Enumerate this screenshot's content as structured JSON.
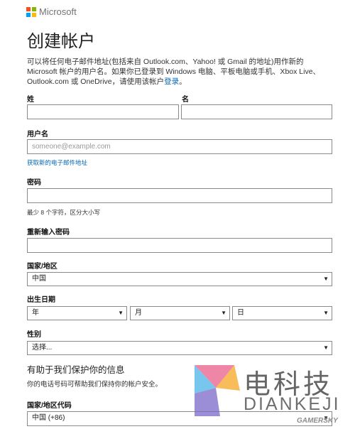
{
  "header": {
    "brand": "Microsoft",
    "logo_colors": [
      "#f25022",
      "#7fba00",
      "#00a4ef",
      "#ffb900"
    ]
  },
  "page_title": "创建帐户",
  "intro": {
    "text_before_link": "可以将任何电子邮件地址(包括来自 Outlook.com、Yahoo! 或 Gmail 的地址)用作新的 Microsoft 帐户的用户名。如果你已登录到 Windows 电脑、平板电脑或手机、Xbox Live、Outlook.com 或 OneDrive，请使用该帐户",
    "link": "登录",
    "text_after_link": "。"
  },
  "fields": {
    "last_name_label": "姓",
    "first_name_label": "名",
    "username_label": "用户名",
    "username_placeholder": "someone@example.com",
    "get_new_email_link": "获取新的电子邮件地址",
    "password_label": "密码",
    "password_hint": "最少 8 个字符，区分大小写",
    "reenter_password_label": "重新输入密码",
    "country_label": "国家/地区",
    "country_value": "中国",
    "birthdate_label": "出生日期",
    "birth_year_value": "年",
    "birth_month_value": "月",
    "birth_day_value": "日",
    "gender_label": "性别",
    "gender_value": "选择...",
    "security_section_title": "有助于我们保护你的信息",
    "security_section_desc": "你的电话号码可帮助我们保持你的帐户安全。",
    "country_code_label": "国家/地区代码",
    "country_code_value": "中国 (+86)"
  },
  "watermark": {
    "cn": "电科技",
    "en": "DIANKEJI",
    "site": "GAMERSKY",
    "colors": [
      "#e85d8b",
      "#f5a623",
      "#4ab3e8",
      "#7b68c8"
    ]
  },
  "colors": {
    "link": "#0067b8",
    "border": "#8a8a8a"
  }
}
